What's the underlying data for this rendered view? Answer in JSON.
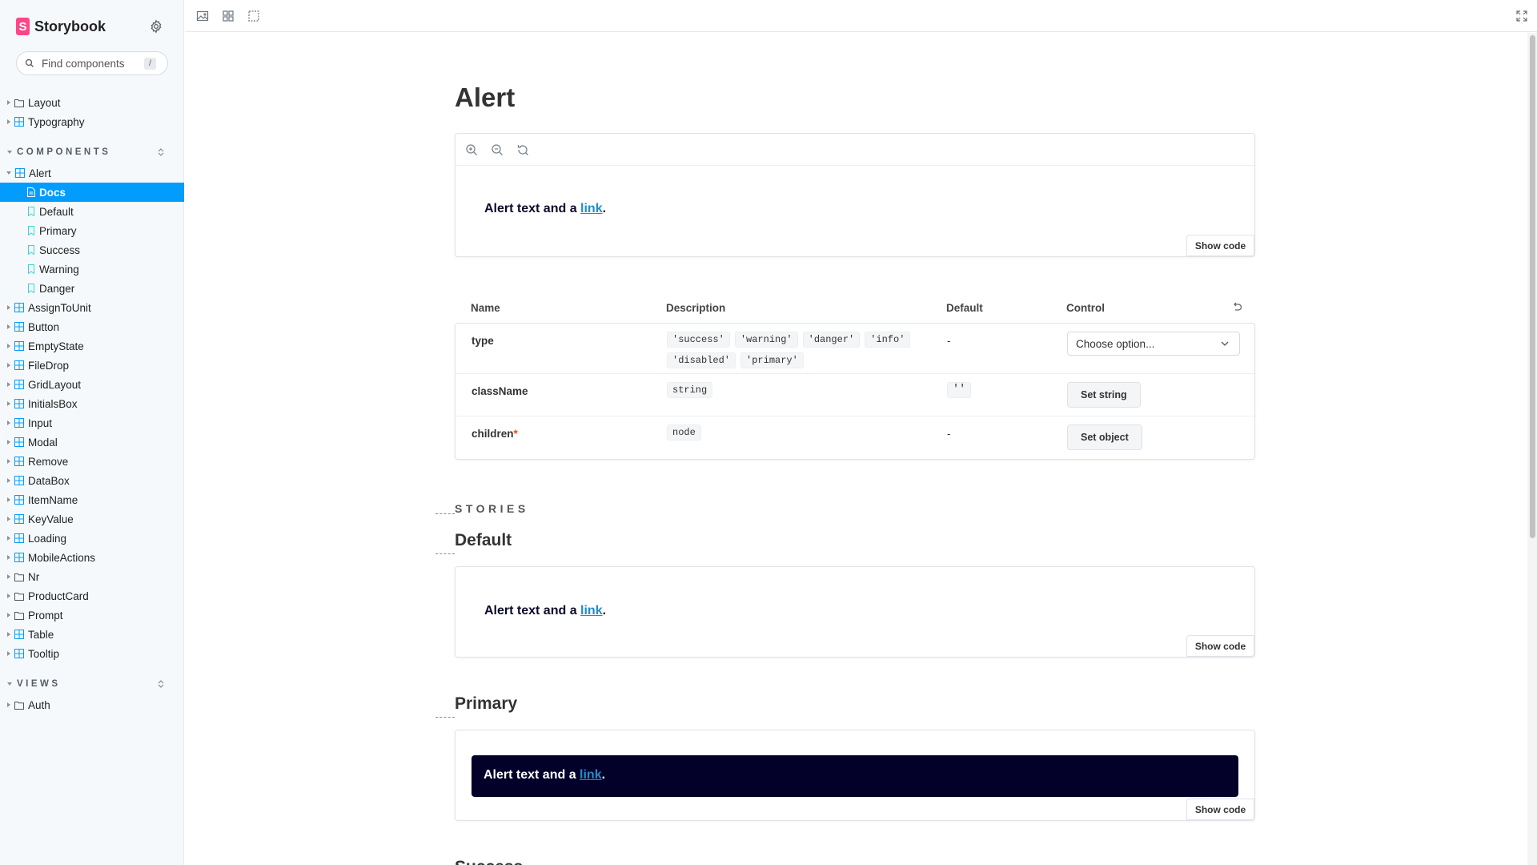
{
  "app": {
    "name": "Storybook",
    "brand_color": "#ff4785",
    "accent_color": "#029cfd"
  },
  "search": {
    "placeholder": "Find components",
    "shortcut": "/"
  },
  "sidebar": {
    "top_items": [
      {
        "label": "Layout",
        "icon": "folder-icon"
      },
      {
        "label": "Typography",
        "icon": "component-icon"
      }
    ],
    "sections": [
      {
        "title": "COMPONENTS",
        "items": [
          {
            "label": "Alert",
            "icon": "component-icon",
            "expanded": true,
            "children": [
              {
                "label": "Docs",
                "icon": "document-icon",
                "active": true
              },
              {
                "label": "Default",
                "icon": "bookmark-icon"
              },
              {
                "label": "Primary",
                "icon": "bookmark-icon"
              },
              {
                "label": "Success",
                "icon": "bookmark-icon"
              },
              {
                "label": "Warning",
                "icon": "bookmark-icon"
              },
              {
                "label": "Danger",
                "icon": "bookmark-icon"
              }
            ]
          },
          {
            "label": "AssignToUnit",
            "icon": "component-icon"
          },
          {
            "label": "Button",
            "icon": "component-icon"
          },
          {
            "label": "EmptyState",
            "icon": "component-icon"
          },
          {
            "label": "FileDrop",
            "icon": "component-icon"
          },
          {
            "label": "GridLayout",
            "icon": "component-icon"
          },
          {
            "label": "InitialsBox",
            "icon": "component-icon"
          },
          {
            "label": "Input",
            "icon": "component-icon"
          },
          {
            "label": "Modal",
            "icon": "component-icon"
          },
          {
            "label": "Remove",
            "icon": "component-icon"
          },
          {
            "label": "DataBox",
            "icon": "component-icon"
          },
          {
            "label": "ItemName",
            "icon": "component-icon"
          },
          {
            "label": "KeyValue",
            "icon": "component-icon"
          },
          {
            "label": "Loading",
            "icon": "component-icon"
          },
          {
            "label": "MobileActions",
            "icon": "component-icon"
          },
          {
            "label": "Nr",
            "icon": "folder-icon"
          },
          {
            "label": "ProductCard",
            "icon": "folder-icon"
          },
          {
            "label": "Prompt",
            "icon": "folder-icon"
          },
          {
            "label": "Table",
            "icon": "component-icon"
          },
          {
            "label": "Tooltip",
            "icon": "component-icon"
          }
        ]
      },
      {
        "title": "VIEWS",
        "items": [
          {
            "label": "Auth",
            "icon": "folder-icon"
          }
        ]
      }
    ]
  },
  "doc": {
    "title": "Alert",
    "alert": {
      "text": "Alert text and a ",
      "link": "link",
      "end": "."
    },
    "show_code": "Show code",
    "args_table": {
      "headers": {
        "name": "Name",
        "description": "Description",
        "default": "Default",
        "control": "Control"
      },
      "rows": [
        {
          "name": "type",
          "required": false,
          "types": [
            "'success'",
            "'warning'",
            "'danger'",
            "'info'",
            "'disabled'",
            "'primary'"
          ],
          "default": "-",
          "control": {
            "kind": "select",
            "label": "Choose option..."
          }
        },
        {
          "name": "className",
          "required": false,
          "types": [
            "string"
          ],
          "default": "''",
          "control": {
            "kind": "button",
            "label": "Set string"
          }
        },
        {
          "name": "children",
          "required": true,
          "required_mark": "*",
          "types": [
            "node"
          ],
          "default": "-",
          "control": {
            "kind": "button",
            "label": "Set object"
          }
        }
      ]
    },
    "stories_label": "STORIES",
    "stories": [
      {
        "title": "Default"
      },
      {
        "title": "Primary"
      },
      {
        "title": "Success"
      }
    ]
  }
}
